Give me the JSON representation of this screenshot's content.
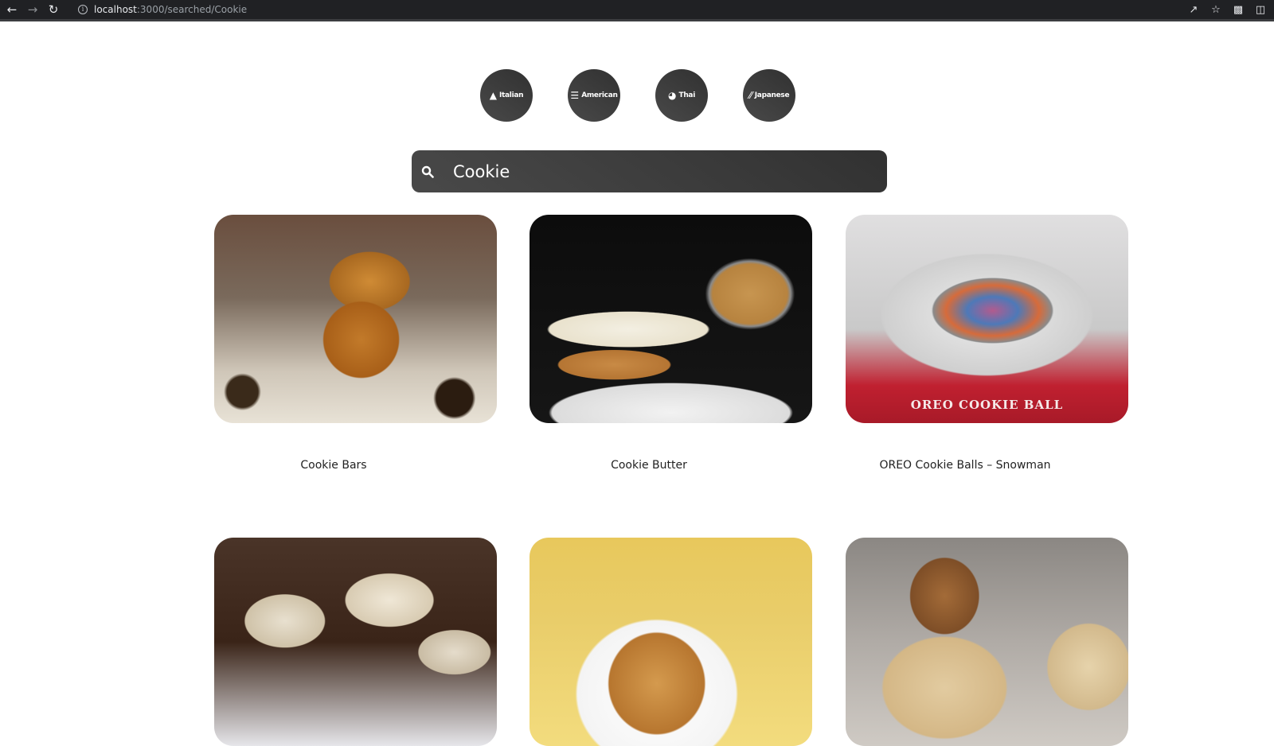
{
  "browser": {
    "url_host": "localhost",
    "url_rest": ":3000/searched/Cookie",
    "icons": [
      "back-arrow-icon",
      "forward-arrow-icon",
      "reload-icon",
      "info-icon",
      "share-icon",
      "star-icon",
      "puzzle-icon",
      "sidebar-icon"
    ]
  },
  "categories": [
    {
      "label": "Italian",
      "icon": "pizza-icon"
    },
    {
      "label": "American",
      "icon": "burger-icon"
    },
    {
      "label": "Thai",
      "icon": "noodle-bowl-icon"
    },
    {
      "label": "Japanese",
      "icon": "chopsticks-icon"
    }
  ],
  "search": {
    "value": "Cookie",
    "icon": "search-icon"
  },
  "recipes": [
    {
      "title": "Cookie Bars"
    },
    {
      "title": "Cookie Butter"
    },
    {
      "title": "OREO Cookie Balls – Snowman",
      "image_text": "OREO   COOKIE BALL"
    },
    {
      "title": ""
    },
    {
      "title": ""
    },
    {
      "title": ""
    }
  ],
  "colors": {
    "button_dark": "#313131",
    "button_light": "#494949",
    "browser_bar": "#202124"
  }
}
